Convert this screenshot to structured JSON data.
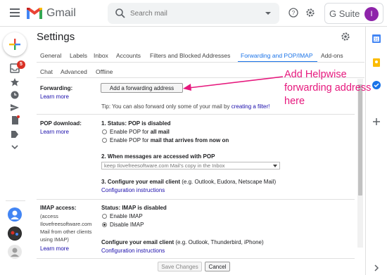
{
  "header": {
    "app_name": "Gmail",
    "search_placeholder": "Search mail",
    "gsuite_label": "G Suite",
    "avatar_initial": "I"
  },
  "rail": {
    "inbox_badge": "5"
  },
  "settings": {
    "title": "Settings",
    "tabs": [
      "General",
      "Labels",
      "Inbox",
      "Accounts",
      "Filters and Blocked Addresses",
      "Forwarding and POP/IMAP",
      "Add-ons",
      "Chat",
      "Advanced",
      "Offline"
    ],
    "active_tab": "Forwarding and POP/IMAP",
    "forwarding": {
      "label": "Forwarding:",
      "learn_more": "Learn more",
      "add_button": "Add a forwarding address",
      "tip_text": "Tip: You can also forward only some of your mail by",
      "tip_link": "creating a filter!"
    },
    "pop": {
      "label": "POP download:",
      "learn_more": "Learn more",
      "status": "1. Status: POP is disabled",
      "opt1_pre": "Enable POP for",
      "opt1_bold": "all mail",
      "opt2_pre": "Enable POP for",
      "opt2_bold": "mail that arrives from now on",
      "step2": "2. When messages are accessed with POP",
      "step2_select": "keep Ilovefreesoftware.com Mail's copy in the Inbox",
      "step3_bold": "3. Configure your email client",
      "step3_rest": "(e.g. Outlook, Eudora, Netscape Mail)",
      "config_link": "Configuration instructions"
    },
    "imap": {
      "label": "IMAP access:",
      "desc_lines": [
        "(access",
        "Ilovefreesoftware.com",
        "Mail from other clients",
        "using IMAP)"
      ],
      "learn_more": "Learn more",
      "status": "Status: IMAP is disabled",
      "opt_enable": "Enable IMAP",
      "opt_disable": "Disable IMAP",
      "client_bold": "Configure your email client",
      "client_rest": "(e.g. Outlook, Thunderbird, iPhone)",
      "config_link": "Configuration instructions"
    },
    "footer": {
      "save": "Save Changes",
      "cancel": "Cancel"
    }
  },
  "annotation": {
    "text": "Add Helpwise forwarding address here",
    "color": "#e6187d"
  },
  "colors": {
    "accent": "#1a73e8",
    "link": "#1a0dab",
    "badge": "#d93025",
    "avatar": "#8e24aa"
  }
}
